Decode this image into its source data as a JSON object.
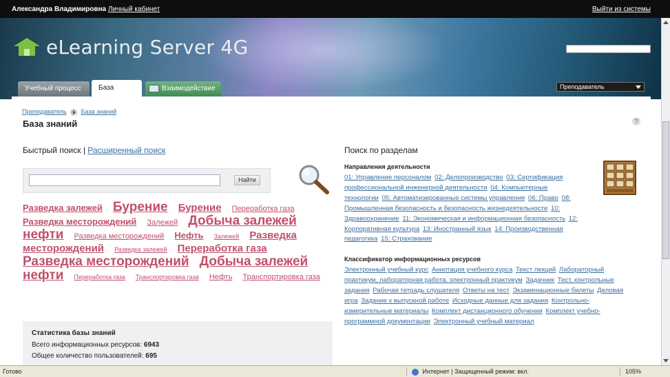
{
  "topbar": {
    "user": "Александра Владимировна",
    "cabinet_link": "Личный кабинет",
    "logout_link": "Выйти из системы"
  },
  "header": {
    "logo_text": "eLearning Server 4G",
    "search_value": ""
  },
  "tabs": [
    {
      "label": "Учебный процесс ▾",
      "active": false
    },
    {
      "label": "База знаний",
      "active": true
    },
    {
      "label": "Взаимодействие ▾",
      "active": false
    }
  ],
  "role_select": {
    "value": "Преподаватель"
  },
  "breadcrumb": {
    "items": [
      "Преподаватель",
      "База знаний"
    ]
  },
  "page_title": "База знаний",
  "help_icon_label": "?",
  "quick_search": {
    "label": "Быстрый поиск",
    "sep": "|",
    "advanced_link": "Расширенный поиск",
    "input_value": "",
    "button_label": "Найти"
  },
  "tag_cloud": [
    {
      "text": "Разведка залежей",
      "size": 3
    },
    {
      "text": "Бурение",
      "size": 5
    },
    {
      "text": "Бурение",
      "size": 4
    },
    {
      "text": "Переработка газа",
      "size": 2
    },
    {
      "text": "Разведка месторождений",
      "size": 3
    },
    {
      "text": "Залежей",
      "size": 2
    },
    {
      "text": "Добыча залежей нефти",
      "size": 5
    },
    {
      "text": "Разведка месторождений",
      "size": 2
    },
    {
      "text": "Нефть",
      "size": 3
    },
    {
      "text": "Залежей",
      "size": 1
    },
    {
      "text": "Разведка месторождений",
      "size": 4
    },
    {
      "text": "Разведка залежей",
      "size": 1
    },
    {
      "text": "Переработка газа",
      "size": 4
    },
    {
      "text": "Разведка месторождений",
      "size": 5
    },
    {
      "text": "Добыча залежей нефти",
      "size": 5
    },
    {
      "text": "Переработка газа",
      "size": 1
    },
    {
      "text": "Транспортировка газа",
      "size": 1
    },
    {
      "text": "Нефть",
      "size": 2
    },
    {
      "text": "Транспортировка газа",
      "size": 2
    }
  ],
  "stats": {
    "heading": "Статистика базы знаний",
    "rows": [
      {
        "label": "Всего информационных ресурсов:",
        "value": "6943"
      },
      {
        "label": "Общее количество пользователей:",
        "value": "695"
      }
    ]
  },
  "sections": {
    "title": "Поиск по разделам",
    "directions": {
      "heading": "Направления деятельности",
      "items": [
        "01: Управление персоналом",
        "02: Делопроизводство",
        "03: Сертификация профессиональной инженерной деятельности",
        "04: Компьютерные технологии",
        "05: Автоматизированные системы управления",
        "06: Право",
        "08: Промышленная безопасность и безопасность жизнедеятельности",
        "10: Здравоохранение",
        "11: Экономическая и информационная безопасность",
        "12: Корпоративная культура",
        "13: Иностранный язык",
        "14: Производственная педагогика",
        "15: Страхование"
      ]
    },
    "classifier": {
      "heading": "Классификатор информационных ресурсов",
      "items": [
        "Электронный учебный курс",
        "Аннотация учебного курса",
        "Текст лекций",
        "Лабораторный практикум, лабораторная работа, электронный практикум",
        "Задачник",
        "Тест, контрольные задания",
        "Рабочая тетрадь слушателя",
        "Ответы на тест",
        "Экзаменационные билеты",
        "Деловая игра",
        "Задание к выпускной работе",
        "Исходные данные для задания",
        "Контрольно-измерительные материалы",
        "Комплект дистанционного обучения",
        "Комплект учебно-программной документации",
        "Электронный учебный материал"
      ]
    }
  },
  "statusbar": {
    "done": "Готово",
    "zone": "Интернет | Защищенный режим: вкл.",
    "zoom": "105%"
  }
}
